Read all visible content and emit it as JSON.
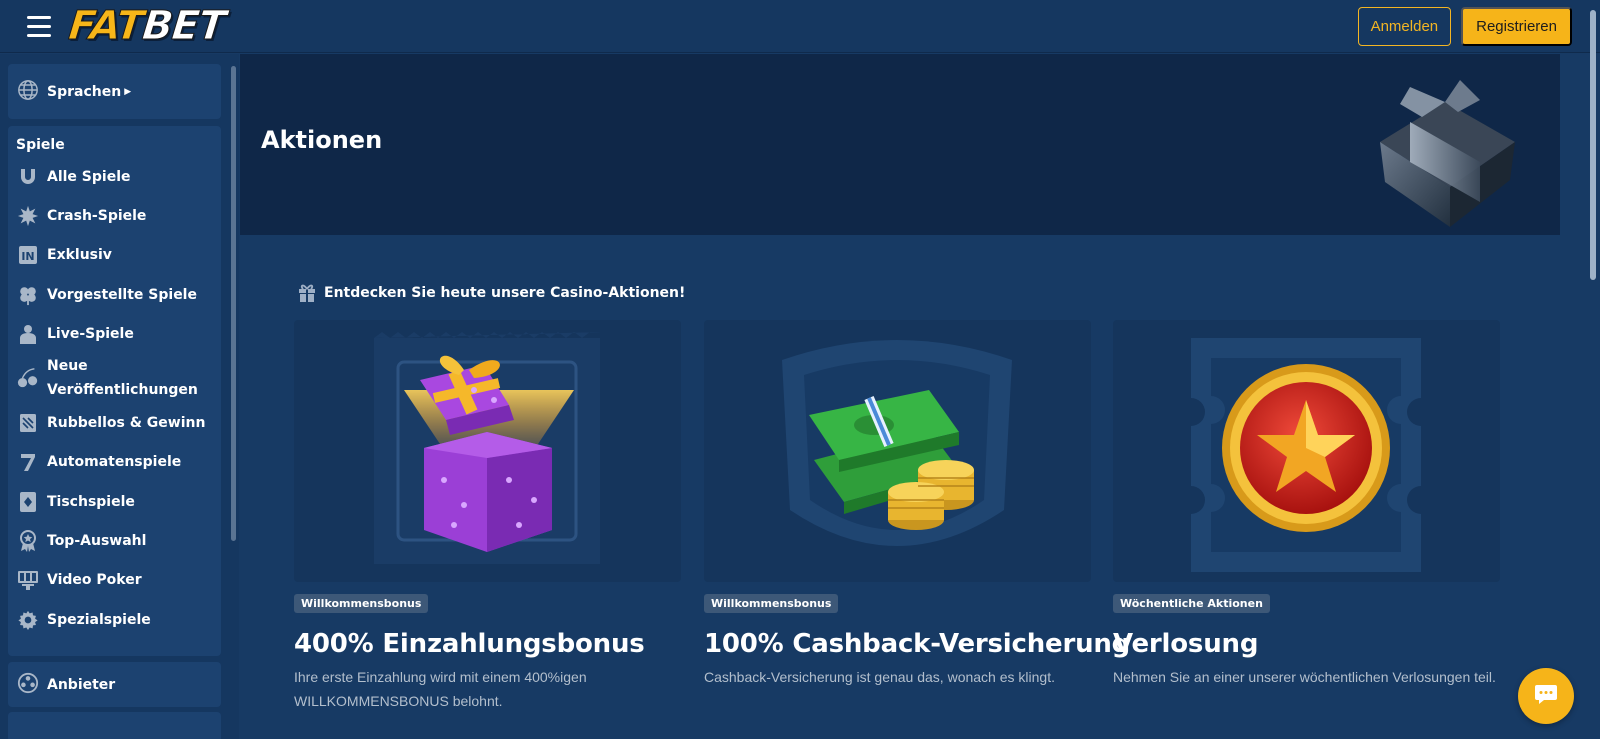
{
  "brand": {
    "logo_part1": "FAT",
    "logo_part2": "BET"
  },
  "header": {
    "login_label": "Anmelden",
    "register_label": "Registrieren"
  },
  "sidebar": {
    "language_label": "Sprachen",
    "games_heading": "Spiele",
    "items": [
      {
        "label": "Alle Spiele",
        "icon": "horseshoe-icon"
      },
      {
        "label": "Crash-Spiele",
        "icon": "explosion-icon"
      },
      {
        "label": "Exklusiv",
        "icon": "exclusive-icon"
      },
      {
        "label": "Vorgestellte Spiele",
        "icon": "clover-icon"
      },
      {
        "label": "Live-Spiele",
        "icon": "dealer-icon"
      },
      {
        "label": "Neue Veröffentlichungen",
        "icon": "cherries-icon"
      },
      {
        "label": "Rubbellos & Gewinn",
        "icon": "scratch-card-icon"
      },
      {
        "label": "Automatenspiele",
        "icon": "seven-icon"
      },
      {
        "label": "Tischspiele",
        "icon": "playing-card-icon"
      },
      {
        "label": "Top-Auswahl",
        "icon": "award-icon"
      },
      {
        "label": "Video Poker",
        "icon": "video-poker-icon"
      },
      {
        "label": "Spezialspiele",
        "icon": "gear-icon"
      }
    ],
    "providers_label": "Anbieter"
  },
  "hero": {
    "title": "Aktionen"
  },
  "promotions": {
    "heading": "Entdecken Sie heute unsere Casino-Aktionen!",
    "cards": [
      {
        "badge": "Willkommensbonus",
        "title": "400% Einzahlungsbonus",
        "description": "Ihre erste Einzahlung wird mit einem 400%igen WILLKOMMENSBONUS belohnt."
      },
      {
        "badge": "Willkommensbonus",
        "title": "100% Cashback-Versicherung",
        "description": "Cashback-Versicherung ist genau das, wonach es klingt."
      },
      {
        "badge": "Wöchentliche Aktionen",
        "title": "Verlosung",
        "description": "Nehmen Sie an einer unserer wöchentlichen Verlosungen teil."
      }
    ]
  },
  "colors": {
    "accent": "#f6b419",
    "background": "#173a64",
    "sidebar": "#153760",
    "hero": "#0f2748"
  }
}
